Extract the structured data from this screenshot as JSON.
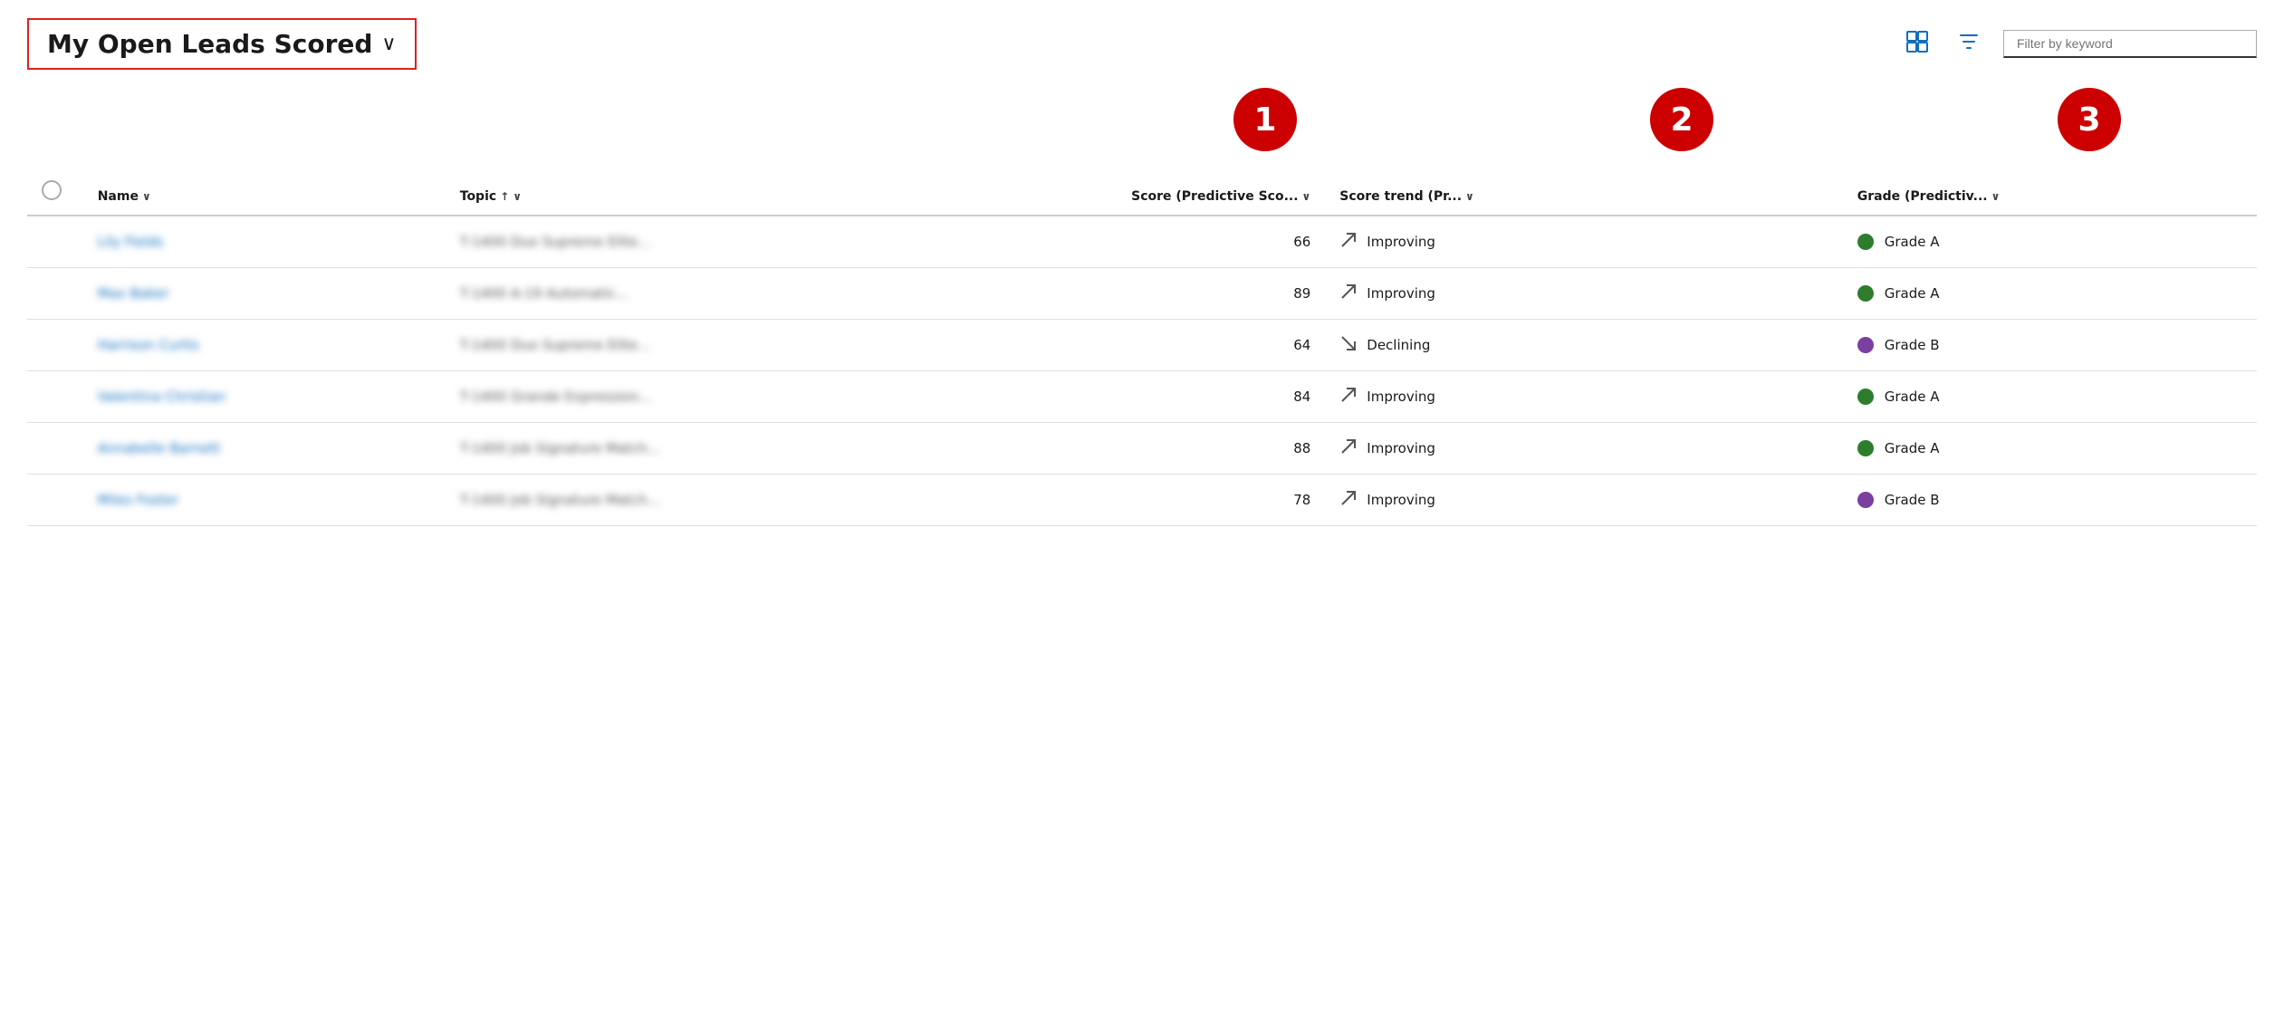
{
  "header": {
    "title": "My Open Leads Scored",
    "chevron": "∨",
    "filter_placeholder": "Filter by keyword",
    "edit_columns_icon": "⊞",
    "filter_icon": "⛉"
  },
  "annotations": [
    {
      "number": "1",
      "position": "score"
    },
    {
      "number": "2",
      "position": "trend"
    },
    {
      "number": "3",
      "position": "grade"
    }
  ],
  "columns": {
    "checkbox": "",
    "name": "Name",
    "topic": "Topic",
    "score": "Score (Predictive Sco...",
    "score_trend": "Score trend (Pr...",
    "grade": "Grade (Predictiv..."
  },
  "rows": [
    {
      "name": "Lily Fields",
      "topic": "T-1400 Duo Supreme Elite...",
      "score": 66,
      "trend_direction": "improving",
      "trend_label": "Improving",
      "grade_color": "green",
      "grade_label": "Grade A"
    },
    {
      "name": "Max Baker",
      "topic": "T-1400 A-19 Automatic...",
      "score": 89,
      "trend_direction": "improving",
      "trend_label": "Improving",
      "grade_color": "green",
      "grade_label": "Grade A"
    },
    {
      "name": "Harrison Curtis",
      "topic": "T-1400 Duo Supreme Elite...",
      "score": 64,
      "trend_direction": "declining",
      "trend_label": "Declining",
      "grade_color": "purple",
      "grade_label": "Grade B"
    },
    {
      "name": "Valentina Christian",
      "topic": "T-1400 Grande Expression...",
      "score": 84,
      "trend_direction": "improving",
      "trend_label": "Improving",
      "grade_color": "green",
      "grade_label": "Grade A"
    },
    {
      "name": "Annabelle Barnett",
      "topic": "T-1400 Job Signature Match...",
      "score": 88,
      "trend_direction": "improving",
      "trend_label": "Improving",
      "grade_color": "green",
      "grade_label": "Grade A"
    },
    {
      "name": "Miles Foster",
      "topic": "T-1400 Job Signature Match...",
      "score": 78,
      "trend_direction": "improving",
      "trend_label": "Improving",
      "grade_color": "purple",
      "grade_label": "Grade B"
    }
  ]
}
